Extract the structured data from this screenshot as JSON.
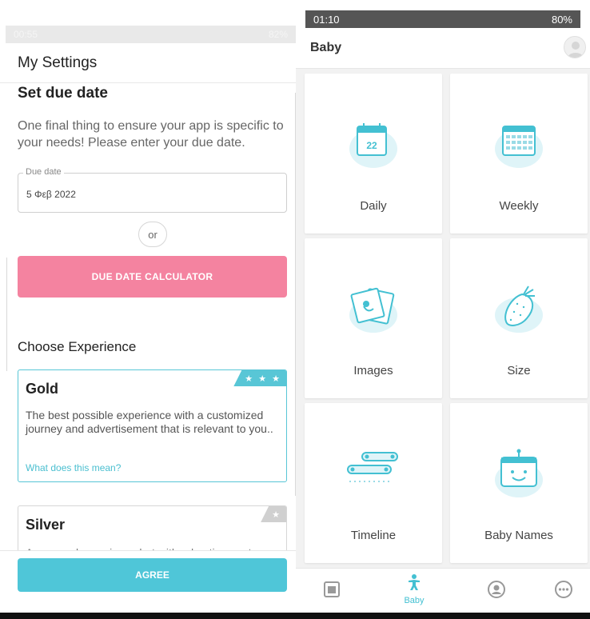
{
  "left": {
    "status_bar": {
      "time": "00:55",
      "battery": "82%"
    },
    "app_title": "My Settings",
    "section_title": "Set due date",
    "intro": "One final thing to ensure your app is specific to your needs! Please enter your due date.",
    "due_date": {
      "label": "Due date",
      "value": "5 Φεβ 2022"
    },
    "or_label": "or",
    "calculator_button": "DUE DATE CALCULATOR",
    "choose_title": "Choose Experience",
    "experiences": [
      {
        "name": "Gold",
        "stars": "★ ★ ★",
        "description": "The best possible experience with a customized journey and advertisement that is relevant to you..",
        "link": "What does this mean?",
        "selected": true
      },
      {
        "name": "Silver",
        "stars": "★",
        "description": "A personal experience but with advertisement",
        "selected": false
      }
    ],
    "agree_button": "AGREE",
    "colors": {
      "pink": "#f483a0",
      "teal": "#4fc6d8"
    }
  },
  "right": {
    "status_bar": {
      "time": "01:10",
      "battery": "80%"
    },
    "app_title": "Baby",
    "tiles": [
      {
        "label": "Daily",
        "icon": "calendar-day-icon",
        "day_number": "22"
      },
      {
        "label": "Weekly",
        "icon": "calendar-week-icon"
      },
      {
        "label": "Images",
        "icon": "photos-icon"
      },
      {
        "label": "Size",
        "icon": "strawberry-icon"
      },
      {
        "label": "Timeline",
        "icon": "timeline-icon"
      },
      {
        "label": "Baby Names",
        "icon": "baby-names-icon"
      }
    ],
    "bottom_nav": {
      "items": [
        {
          "icon": "journal-icon",
          "label": ""
        },
        {
          "icon": "baby-icon",
          "label": "Baby",
          "active": true
        },
        {
          "icon": "profile-icon",
          "label": ""
        },
        {
          "icon": "more-icon",
          "label": ""
        }
      ]
    },
    "colors": {
      "accent": "#43c0d2",
      "icon_bg": "#dff4f8"
    }
  }
}
